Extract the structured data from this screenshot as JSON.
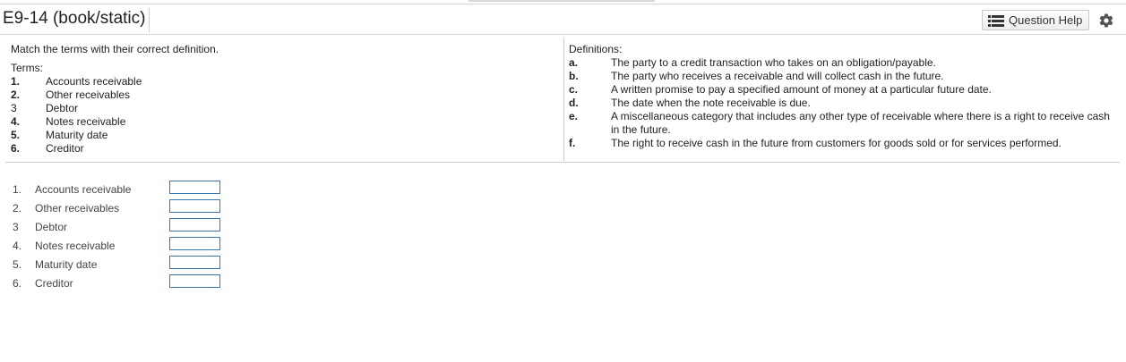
{
  "header": {
    "title": "E9-14 (book/static)",
    "help_label": "Question Help"
  },
  "instruction": "Match the terms with their correct definition.",
  "terms_heading": "Terms:",
  "terms": [
    {
      "num": "1.",
      "label": "Accounts receivable"
    },
    {
      "num": "2.",
      "label": "Other receivables"
    },
    {
      "num": "3",
      "label": "Debtor"
    },
    {
      "num": "4.",
      "label": "Notes receivable"
    },
    {
      "num": "5.",
      "label": "Maturity date"
    },
    {
      "num": "6.",
      "label": "Creditor"
    }
  ],
  "definitions_heading": "Definitions:",
  "definitions": [
    {
      "letter": "a.",
      "text": "The party to a credit transaction who takes on an obligation/payable."
    },
    {
      "letter": "b.",
      "text": "The party who receives a receivable and will collect cash in the future."
    },
    {
      "letter": "c.",
      "text": "A written promise to pay a specified amount of money at a particular future date."
    },
    {
      "letter": "d.",
      "text": "The date when the note receivable is due."
    },
    {
      "letter": "e.",
      "text": "A miscellaneous category that includes any other type of receivable where there is a right to receive cash in the future."
    },
    {
      "letter": "f.",
      "text": "The right to receive cash in the future from customers for goods sold or for services performed."
    }
  ],
  "answers": [
    {
      "num": "1.",
      "label": "Accounts receivable",
      "value": ""
    },
    {
      "num": "2.",
      "label": "Other receivables",
      "value": ""
    },
    {
      "num": "3",
      "label": "Debtor",
      "value": ""
    },
    {
      "num": "4.",
      "label": "Notes receivable",
      "value": ""
    },
    {
      "num": "5.",
      "label": "Maturity date",
      "value": ""
    },
    {
      "num": "6.",
      "label": "Creditor",
      "value": ""
    }
  ],
  "colors": {
    "input_border": "#3a79b0",
    "divider": "#c9c9c9"
  },
  "icons": {
    "help": "list-icon",
    "settings": "gear-icon"
  }
}
